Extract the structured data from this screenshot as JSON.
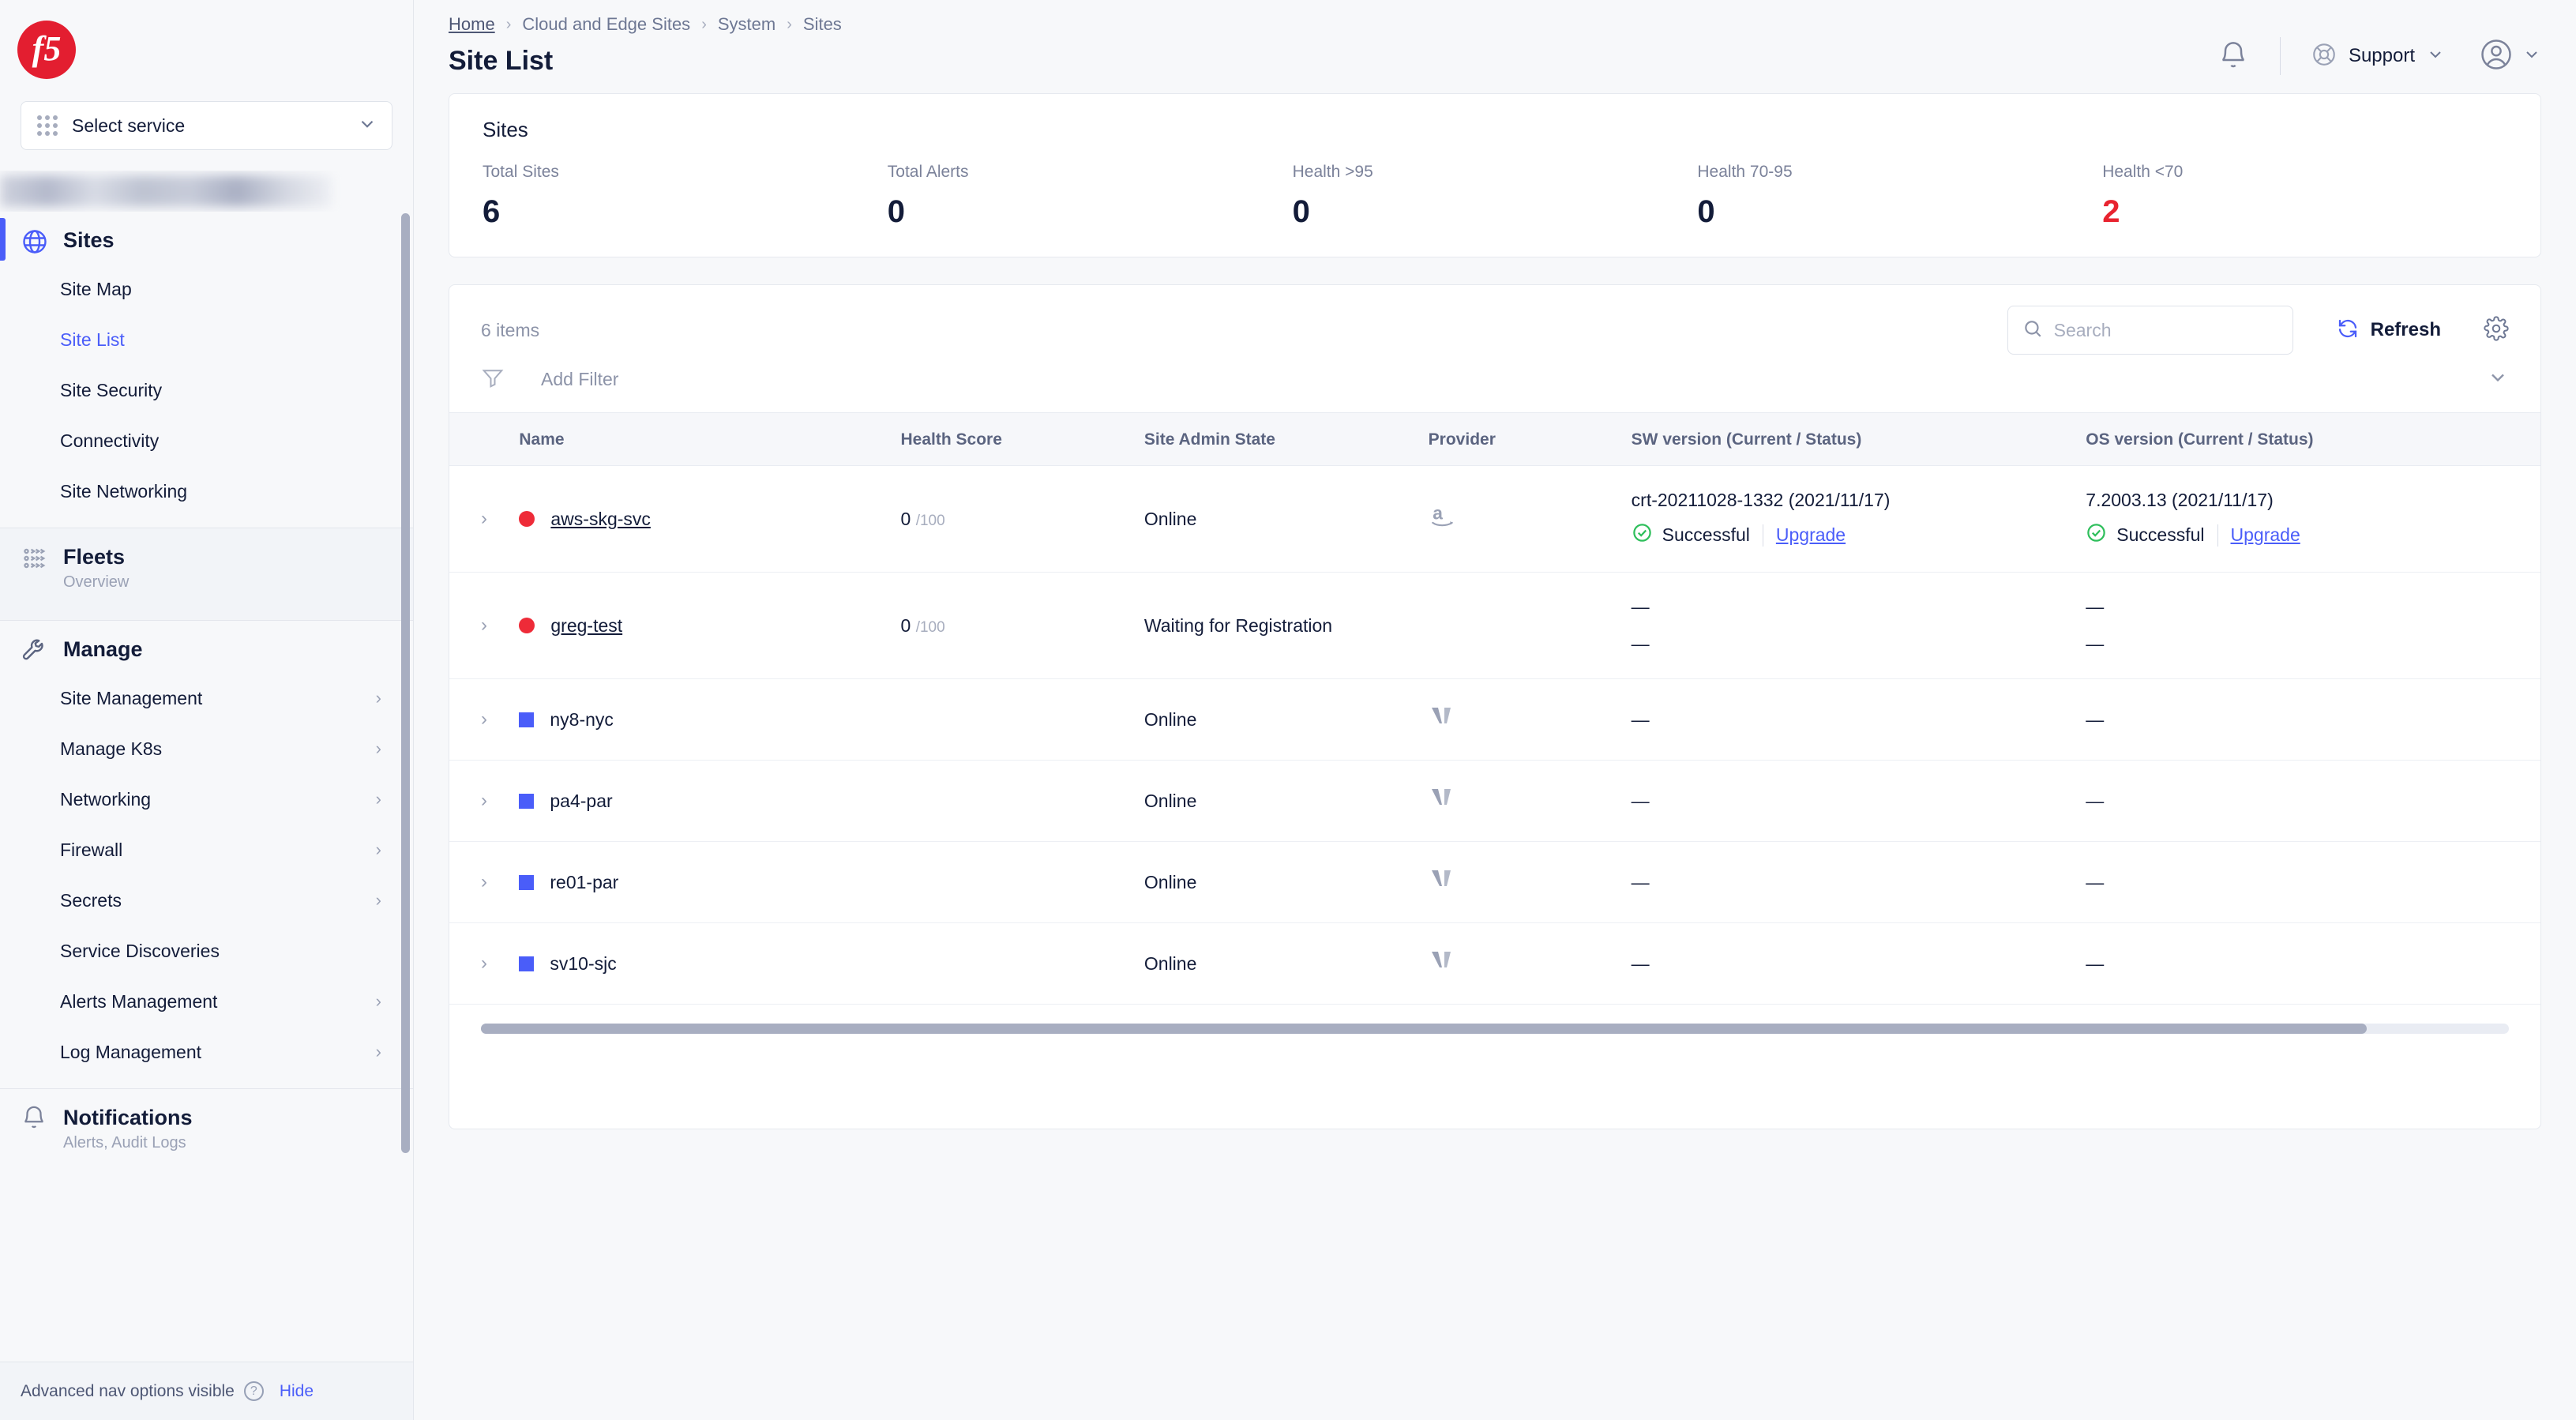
{
  "brand": {
    "logo_text": "f5",
    "logo_color": "#e31e30"
  },
  "sidebar": {
    "service_select": {
      "label": "Select service",
      "icon": "grid-icon",
      "chevron": "chevron-down-icon"
    },
    "sections": [
      {
        "title": "Sites",
        "icon": "globe-icon",
        "active": true,
        "items": [
          {
            "label": "Site Map",
            "selected": false,
            "expandable": false
          },
          {
            "label": "Site List",
            "selected": true,
            "expandable": false
          },
          {
            "label": "Site Security",
            "selected": false,
            "expandable": false
          },
          {
            "label": "Connectivity",
            "selected": false,
            "expandable": false
          },
          {
            "label": "Site Networking",
            "selected": false,
            "expandable": false
          }
        ]
      },
      {
        "title": "Fleets",
        "subtitle": "Overview",
        "icon": "fleet-icon",
        "active": false,
        "items": []
      },
      {
        "title": "Manage",
        "icon": "wrench-icon",
        "active": false,
        "items": [
          {
            "label": "Site Management",
            "selected": false,
            "expandable": true
          },
          {
            "label": "Manage K8s",
            "selected": false,
            "expandable": true
          },
          {
            "label": "Networking",
            "selected": false,
            "expandable": true
          },
          {
            "label": "Firewall",
            "selected": false,
            "expandable": true
          },
          {
            "label": "Secrets",
            "selected": false,
            "expandable": true
          },
          {
            "label": "Service Discoveries",
            "selected": false,
            "expandable": false
          },
          {
            "label": "Alerts Management",
            "selected": false,
            "expandable": true
          },
          {
            "label": "Log Management",
            "selected": false,
            "expandable": true
          }
        ]
      },
      {
        "title": "Notifications",
        "subtitle": "Alerts, Audit Logs",
        "icon": "bell-icon",
        "active": false,
        "items": []
      }
    ],
    "footer": {
      "text": "Advanced nav options visible",
      "help_icon": "question-circle-icon",
      "hide_label": "Hide"
    }
  },
  "header": {
    "breadcrumbs": [
      "Home",
      "Cloud and Edge Sites",
      "System",
      "Sites"
    ],
    "title": "Site List",
    "bell_icon": "bell-icon",
    "support_label": "Support",
    "support_icon": "lifering-icon",
    "support_chevron": "chevron-down-icon",
    "avatar_icon": "user-avatar-icon",
    "avatar_chevron": "chevron-down-icon"
  },
  "stats": {
    "title": "Sites",
    "items": [
      {
        "label": "Total Sites",
        "value": "6",
        "danger": false
      },
      {
        "label": "Total Alerts",
        "value": "0",
        "danger": false
      },
      {
        "label": "Health >95",
        "value": "0",
        "danger": false
      },
      {
        "label": "Health 70-95",
        "value": "0",
        "danger": false
      },
      {
        "label": "Health <70",
        "value": "2",
        "danger": true
      }
    ],
    "danger_color": "#e8232f"
  },
  "toolbar": {
    "items_count": "6 items",
    "search_placeholder": "Search",
    "search_value": "",
    "search_icon": "search-icon",
    "refresh_label": "Refresh",
    "refresh_icon": "refresh-icon",
    "settings_icon": "gear-icon",
    "filter_icon": "filter-icon",
    "add_filter_label": "Add Filter",
    "expand_chevron": "chevron-down-icon"
  },
  "table": {
    "columns": [
      "Name",
      "Health Score",
      "Site Admin State",
      "Provider",
      "SW version (Current / Status)",
      "OS version (Current / Status)"
    ],
    "status_successful": "Successful",
    "upgrade_label": "Upgrade",
    "health_max": "/100",
    "dash": "—",
    "rows": [
      {
        "marker": "red-dot",
        "name": "aws-skg-svc",
        "name_link": true,
        "health": "0",
        "state": "Online",
        "provider": "aws-icon",
        "sw_version": "crt-20211028-1332 (2021/11/17)",
        "sw_status": "Successful",
        "os_version": "7.2003.13 (2021/11/17)",
        "os_status": "Successful"
      },
      {
        "marker": "red-dot",
        "name": "greg-test",
        "name_link": true,
        "health": "0",
        "state": "Waiting for Registration",
        "provider": "",
        "sw_version": "—",
        "sw_status": "—",
        "os_version": "—",
        "os_status": "—"
      },
      {
        "marker": "blue-square",
        "name": "ny8-nyc",
        "name_link": false,
        "health": "",
        "state": "Online",
        "provider": "volterra-icon",
        "sw_version": "—",
        "sw_status": "",
        "os_version": "—",
        "os_status": ""
      },
      {
        "marker": "blue-square",
        "name": "pa4-par",
        "name_link": false,
        "health": "",
        "state": "Online",
        "provider": "volterra-icon",
        "sw_version": "—",
        "sw_status": "",
        "os_version": "—",
        "os_status": ""
      },
      {
        "marker": "blue-square",
        "name": "re01-par",
        "name_link": false,
        "health": "",
        "state": "Online",
        "provider": "volterra-icon",
        "sw_version": "—",
        "sw_status": "",
        "os_version": "—",
        "os_status": ""
      },
      {
        "marker": "blue-square",
        "name": "sv10-sjc",
        "name_link": false,
        "health": "",
        "state": "Online",
        "provider": "volterra-icon",
        "sw_version": "—",
        "sw_status": "",
        "os_version": "—",
        "os_status": ""
      }
    ]
  }
}
